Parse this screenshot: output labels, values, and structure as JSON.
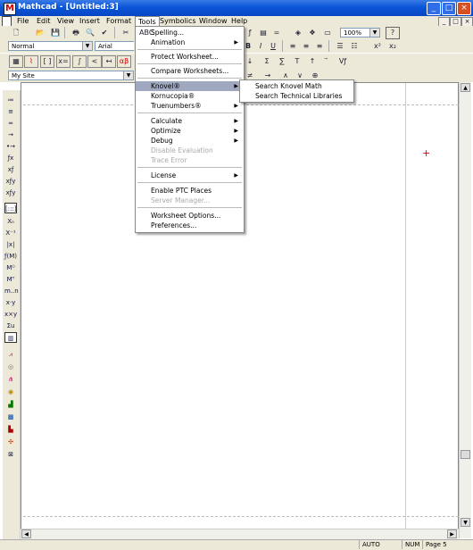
{
  "window": {
    "title": "Mathcad - [Untitled:3]",
    "minimize": "_",
    "maximize": "□",
    "close": "×"
  },
  "menubar": [
    "File",
    "Edit",
    "View",
    "Insert",
    "Format",
    "Tools",
    "Symbolics",
    "Window",
    "Help"
  ],
  "mdi_buttons": [
    "_",
    "□",
    "×"
  ],
  "toolbar": {
    "zoom": "100%",
    "help": "?"
  },
  "format_bar": {
    "style": "Normal",
    "font": "Arial",
    "bold": "B",
    "italic": "I",
    "underline": "U"
  },
  "resource_bar": {
    "site": "My Site"
  },
  "math_row": [
    "≠",
    "→",
    "∧",
    "∨",
    "⊕"
  ],
  "tools_menu": {
    "items": [
      {
        "label": "Spelling...",
        "check": "ABC"
      },
      {
        "label": "Animation",
        "arrow": "▶"
      },
      {
        "label": "Protect Worksheet..."
      },
      {
        "label": "Compare Worksheets..."
      },
      {
        "label": "Knovel®",
        "arrow": "▶"
      },
      {
        "label": "Kornucopia®"
      },
      {
        "label": "Truenumbers®",
        "arrow": "▶"
      },
      {
        "label": "Calculate",
        "arrow": "▶"
      },
      {
        "label": "Optimize",
        "arrow": "▶"
      },
      {
        "label": "Debug",
        "arrow": "▶"
      },
      {
        "label": "Disable Evaluation"
      },
      {
        "label": "Trace Error"
      },
      {
        "label": "License",
        "arrow": "▶"
      },
      {
        "label": "Enable PTC Places"
      },
      {
        "label": "Server Manager..."
      },
      {
        "label": "Worksheet Options..."
      },
      {
        "label": "Preferences..."
      }
    ]
  },
  "knovel_submenu": [
    "Search Knovel Math",
    "Search Technical Libraries"
  ],
  "status": {
    "mode": "AUTO",
    "num": "NUM",
    "page": "Page 5"
  },
  "colors": {
    "titlebar": "#0a55d8",
    "highlight": "#9fa8bf",
    "chrome": "#ece9d8",
    "cursor": "#d00000"
  }
}
